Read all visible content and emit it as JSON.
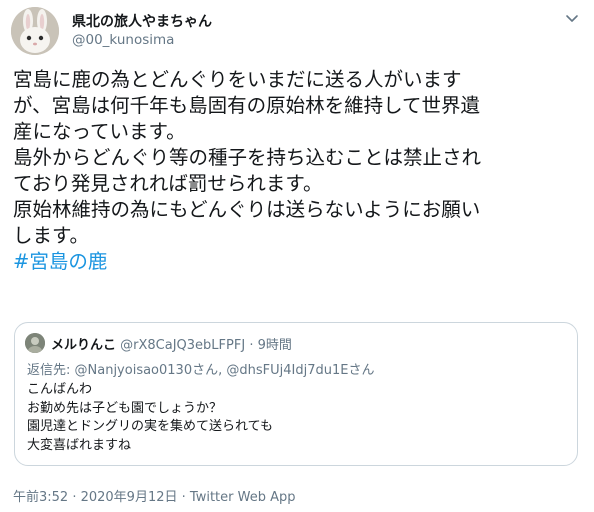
{
  "author": {
    "display_name": "県北の旅人やまちゃん",
    "handle": "@00_kunosima"
  },
  "tweet": {
    "lines": [
      "宮島に鹿の為とどんぐりをいまだに送る人がいます",
      "が、宮島は何千年も島固有の原始林を維持して世界遺",
      "産になっています。",
      "島外からどんぐり等の種子を持ち込むことは禁止され",
      "ており発見されれば罰せられます。",
      "原始林維持の為にもどんぐりは送らないようにお願い",
      "します。"
    ],
    "hashtag": "#宮島の鹿"
  },
  "quoted_tweet": {
    "display_name": "メルりんこ",
    "handle": "@rX8CaJQ3ebLFPFJ",
    "separator": "·",
    "time": "9時間",
    "reply_to": "返信先: @Nanjyoisao0130さん, @dhsFUj4Idj7du1Eさん",
    "lines": [
      "こんばんわ",
      "お勤め先は子ども園でしょうか？",
      "園児達とドングリの実を集めて送られても",
      "大変喜ばれますね"
    ]
  },
  "meta": {
    "timestamp": "午前3:52 · 2020年9月12日",
    "separator": "·",
    "source": "Twitter Web App"
  },
  "icons": {
    "menu": "chevron-down-icon",
    "avatar": "rabbit-avatar",
    "quoted_avatar": "user-avatar"
  },
  "colors": {
    "text": "#14171a",
    "secondary": "#657786",
    "link": "#1b95e0",
    "border": "#ccd6dd"
  }
}
